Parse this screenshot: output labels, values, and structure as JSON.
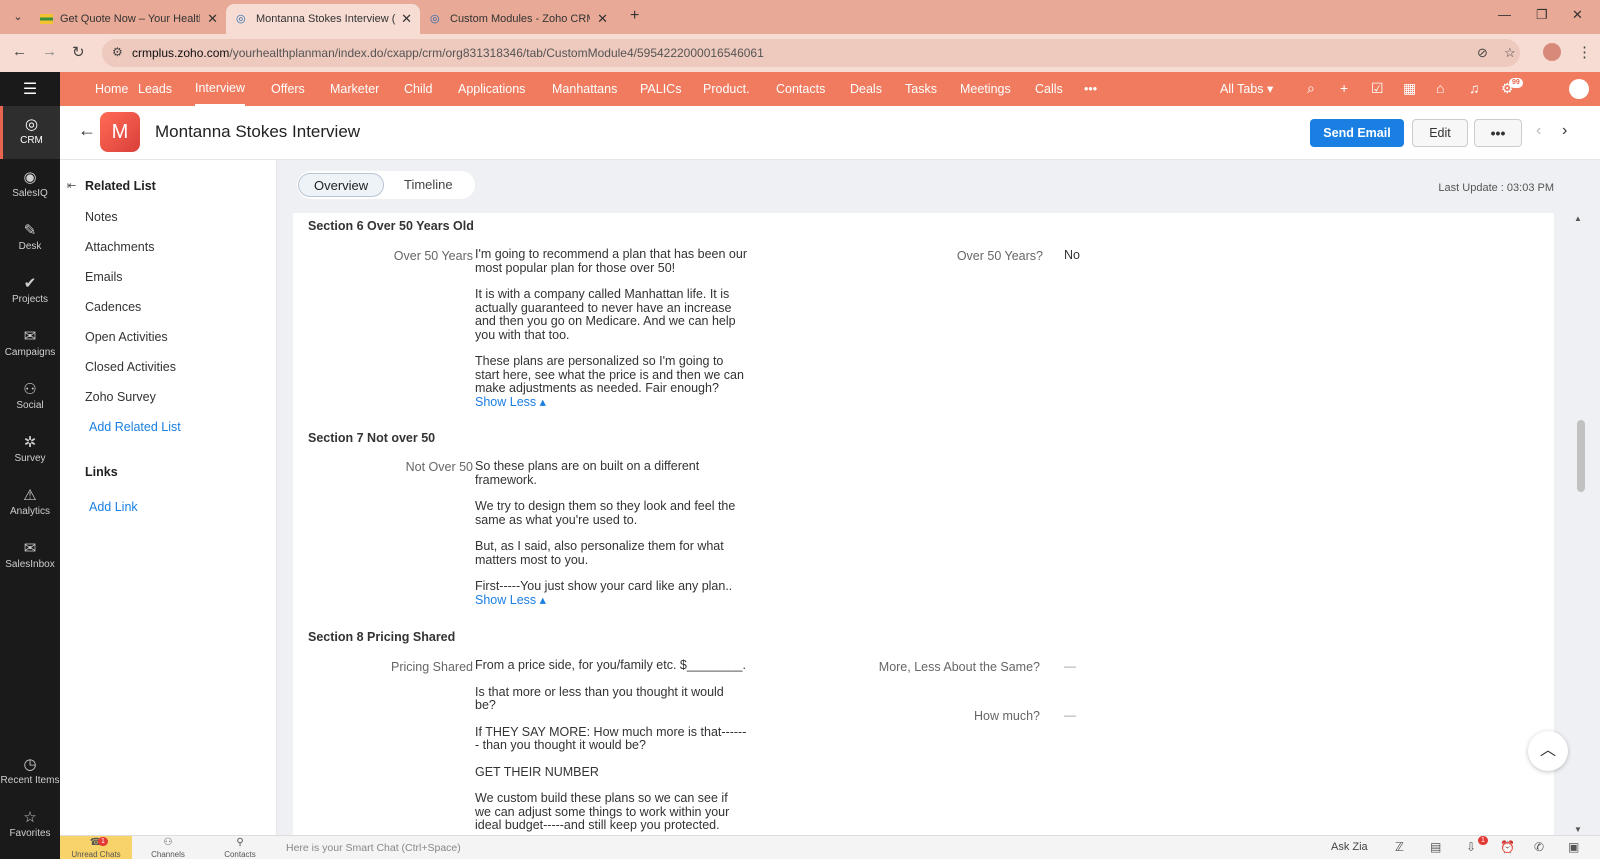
{
  "browser": {
    "tabs": [
      {
        "title": "Get Quote Now – Your Health P",
        "active": false
      },
      {
        "title": "Montanna Stokes Interview (Int",
        "active": true
      },
      {
        "title": "Custom Modules - Zoho CRM",
        "active": false
      }
    ],
    "url_domain": "crmplus.zoho.com",
    "url_path": "/yourhealthplanman/index.do/cxapp/crm/org831318346/tab/CustomModule4/5954222000016546061"
  },
  "rail": {
    "items": [
      {
        "label": "CRM",
        "icon": "crm-icon",
        "glyph": "◎"
      },
      {
        "label": "SalesIQ",
        "icon": "salesiq-icon",
        "glyph": "◉"
      },
      {
        "label": "Desk",
        "icon": "desk-icon",
        "glyph": "✎"
      },
      {
        "label": "Projects",
        "icon": "projects-icon",
        "glyph": "✔"
      },
      {
        "label": "Campaigns",
        "icon": "campaigns-icon",
        "glyph": "✉"
      },
      {
        "label": "Social",
        "icon": "social-icon",
        "glyph": "⚇"
      },
      {
        "label": "Survey",
        "icon": "survey-icon",
        "glyph": "✲"
      },
      {
        "label": "Analytics",
        "icon": "analytics-icon",
        "glyph": "⚠"
      },
      {
        "label": "SalesInbox",
        "icon": "salesinbox-icon",
        "glyph": "✉"
      }
    ],
    "bottom": [
      {
        "label": "Recent Items",
        "icon": "clock-icon",
        "glyph": "◷"
      },
      {
        "label": "Favorites",
        "icon": "star-icon",
        "glyph": "☆"
      }
    ]
  },
  "nav": {
    "items": [
      "Home",
      "Leads",
      "Interview",
      "Offers",
      "Marketer",
      "Child",
      "Applications",
      "Manhattans",
      "PALICs",
      "Product.",
      "Contacts",
      "Deals",
      "Tasks",
      "Meetings",
      "Calls"
    ],
    "active": "Interview",
    "all_tabs": "All Tabs",
    "notif_count": "99"
  },
  "record": {
    "avatar_letter": "M",
    "title": "Montanna Stokes Interview",
    "send_email": "Send Email",
    "edit": "Edit",
    "more": "•••"
  },
  "related": {
    "heading": "Related List",
    "items": [
      "Notes",
      "Attachments",
      "Emails",
      "Cadences",
      "Open Activities",
      "Closed Activities",
      "Zoho Survey"
    ],
    "add_related": "Add Related List",
    "links_heading": "Links",
    "add_link": "Add Link"
  },
  "tabs": {
    "overview": "Overview",
    "timeline": "Timeline"
  },
  "last_update": "Last Update : 03:03 PM",
  "sections": {
    "s6": {
      "title": "Section 6 Over 50 Years Old",
      "label": "Over 50 Years",
      "paras": [
        "I'm going to recommend a plan that has been our most popular plan for those over 50!",
        "It is with a company called Manhattan life. It is actually guaranteed to never have an increase and then you go on Medicare. And we can help you with that too.",
        "These plans are personalized so I'm going to start here, see what the price is and then we can make adjustments as needed. Fair enough?"
      ],
      "show_less": "Show Less",
      "right_label": "Over 50 Years?",
      "right_value": "No"
    },
    "s7": {
      "title": "Section 7 Not over 50",
      "label": "Not Over 50",
      "paras": [
        "So these plans are on built on a different framework.",
        "We try to design them so they look and feel the same as what you're used to.",
        "But, as I said, also personalize them for what matters most to you.",
        "First-----You just show your card like any plan.."
      ],
      "show_less": "Show Less"
    },
    "s8": {
      "title": "Section 8 Pricing Shared",
      "label": "Pricing Shared",
      "paras": [
        "From a price side, for you/family etc. $________.",
        "Is that more or less than you thought it would be?",
        "If THEY SAY MORE: How much more is that------- than you thought it would be?",
        "GET THEIR NUMBER",
        "We custom build these plans so we can see if we can adjust some things to work within your ideal budget-----and still keep you protected."
      ],
      "right_label1": "More, Less About the Same?",
      "right_value1": "—",
      "right_label2": "How much?",
      "right_value2": "—"
    }
  },
  "bottombar": {
    "unread_chats": "Unread Chats",
    "unread_count": "1",
    "channels": "Channels",
    "contacts": "Contacts",
    "smart_chat": "Here is your Smart Chat (Ctrl+Space)",
    "ask_zia": "Ask Zia",
    "download_count": "1"
  },
  "colors": {
    "brand": "#f07b5f",
    "primary_button": "#1a7fe3",
    "link": "#1a7fe3"
  }
}
